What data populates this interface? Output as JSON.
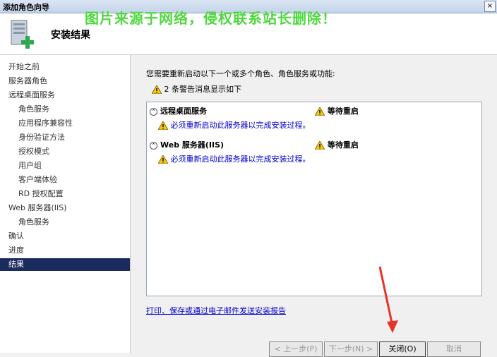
{
  "window": {
    "title": "添加角色向导",
    "close_label": "×"
  },
  "watermark": "图片来源于网络，侵权联系站长删除！",
  "header": {
    "title": "安装结果"
  },
  "sidebar": {
    "items": [
      {
        "label": "开始之前",
        "indent": false,
        "active": false
      },
      {
        "label": "服务器角色",
        "indent": false,
        "active": false
      },
      {
        "label": "远程桌面服务",
        "indent": false,
        "active": false
      },
      {
        "label": "角色服务",
        "indent": true,
        "active": false
      },
      {
        "label": "应用程序兼容性",
        "indent": true,
        "active": false
      },
      {
        "label": "身份验证方法",
        "indent": true,
        "active": false
      },
      {
        "label": "授权模式",
        "indent": true,
        "active": false
      },
      {
        "label": "用户组",
        "indent": true,
        "active": false
      },
      {
        "label": "客户端体验",
        "indent": true,
        "active": false
      },
      {
        "label": "RD 授权配置",
        "indent": true,
        "active": false
      },
      {
        "label": "Web 服务器(IIS)",
        "indent": false,
        "active": false
      },
      {
        "label": "角色服务",
        "indent": true,
        "active": false
      },
      {
        "label": "确认",
        "indent": false,
        "active": false
      },
      {
        "label": "进度",
        "indent": false,
        "active": false
      },
      {
        "label": "结果",
        "indent": false,
        "active": true
      }
    ]
  },
  "main": {
    "message": "您需要重新启动以下一个或多个角色、角色服务或功能:",
    "warning_summary": "2 条警告消息显示如下",
    "results": [
      {
        "name": "远程桌面服务",
        "status": "等待重启",
        "detail": "必须重新启动此服务器以完成安装过程。"
      },
      {
        "name": "Web 服务器(IIS)",
        "status": "等待重启",
        "detail": "必须重新启动此服务器以完成安装过程。"
      }
    ],
    "report_link": "打印、保存或通过电子邮件发送安装报告"
  },
  "buttons": {
    "back": "< 上一步(P)",
    "next": "下一步(N) >",
    "close": "关闭(O)",
    "cancel": "取消"
  },
  "colors": {
    "selection": "#1b2b5e",
    "link": "#0000cc",
    "watermark": "#4fd83f",
    "arrow": "#e8322a"
  }
}
